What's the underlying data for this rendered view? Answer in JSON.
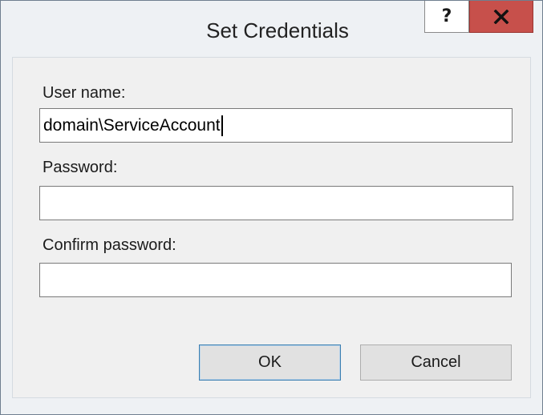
{
  "window": {
    "title": "Set Credentials",
    "help_label": "?",
    "close_icon": "close-icon"
  },
  "form": {
    "username_label": "User name:",
    "username_value": "domain\\ServiceAccount",
    "password_label": "Password:",
    "password_value": "",
    "confirm_label": "Confirm password:",
    "confirm_value": ""
  },
  "buttons": {
    "ok_label": "OK",
    "cancel_label": "Cancel"
  },
  "colors": {
    "close_button": "#c7504b",
    "dialog_background": "#f0f0f0"
  }
}
